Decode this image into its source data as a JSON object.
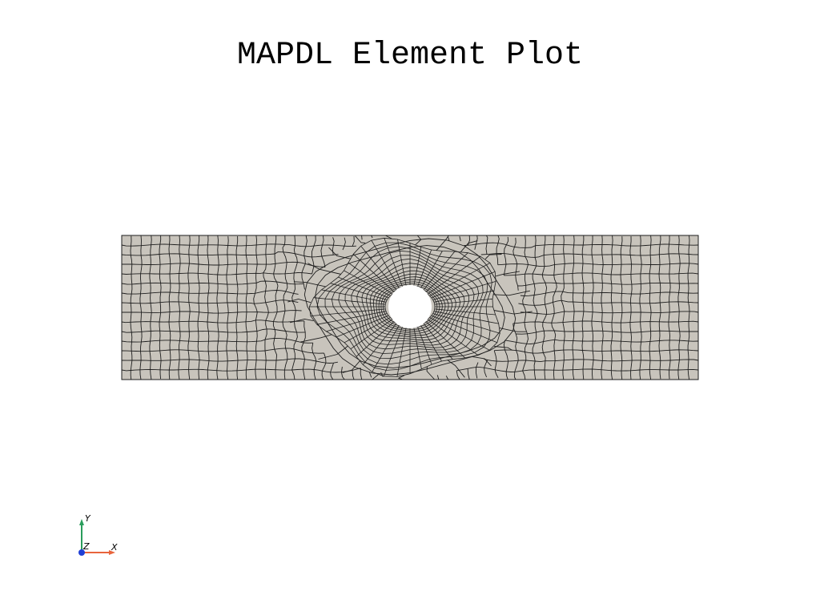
{
  "title": "MAPDL Element Plot",
  "colors": {
    "background": "#ffffff",
    "mesh_fill": "#c8c4bc",
    "mesh_line": "#1e1e1e",
    "hole": "#ffffff",
    "axis_x": "#e8643c",
    "axis_y": "#2a9d5c",
    "axis_z": "#1f3fd6"
  },
  "mesh": {
    "element_type": "quadrilateral",
    "has_hole": true
  },
  "axes_triad": {
    "x_label": "X",
    "y_label": "Y",
    "z_label": "Z"
  }
}
